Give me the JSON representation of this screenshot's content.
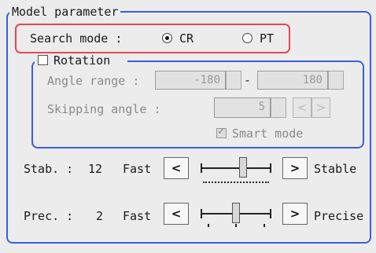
{
  "group_title": "Model parameter",
  "search_mode": {
    "label": "Search mode :",
    "options": [
      {
        "label": "CR",
        "selected": true
      },
      {
        "label": "PT",
        "selected": false
      }
    ]
  },
  "rotation": {
    "label": "Rotation",
    "checked": false,
    "angle_range_label": "Angle range :",
    "angle_min": "-180",
    "angle_sep": "-",
    "angle_max": "180",
    "skipping_angle_label": "Skipping angle :",
    "skipping_angle": "5",
    "smart_mode_label": "Smart mode",
    "smart_mode_checked": true
  },
  "stab": {
    "label": "Stab. :",
    "value": "12",
    "min_label": "Fast",
    "max_label": "Stable",
    "dec_btn": "<",
    "inc_btn": ">",
    "level_fraction": 0.6
  },
  "prec": {
    "label": "Prec. :",
    "value": "2",
    "min_label": "Fast",
    "max_label": "Precise",
    "dec_btn": "<",
    "inc_btn": ">",
    "level_fraction": 0.5
  },
  "colors": {
    "group_border": "#3a5fd9",
    "highlight": "#e2465a"
  }
}
